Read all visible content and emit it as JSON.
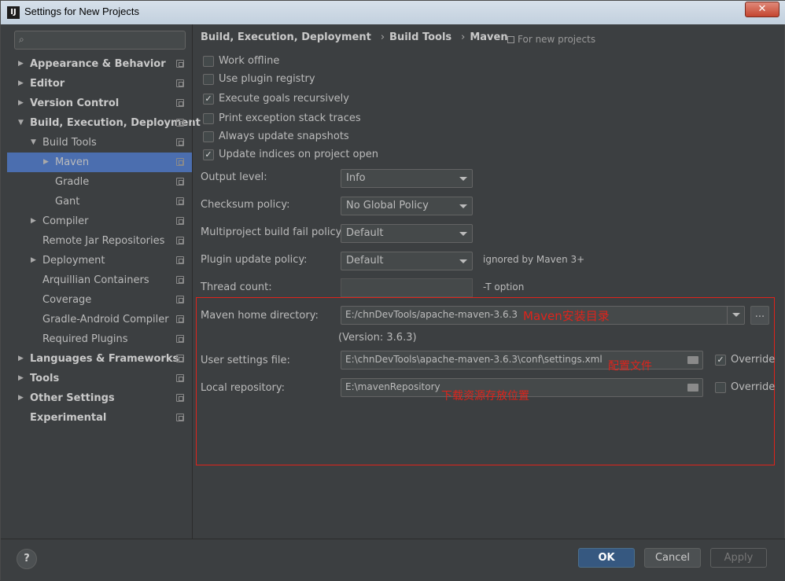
{
  "window": {
    "title": "Settings for New Projects",
    "close_label": "✕",
    "app_icon": "IJ"
  },
  "search": {
    "placeholder": "",
    "icon": "search-icon"
  },
  "sidebar": {
    "items": [
      {
        "label": "Appearance & Behavior",
        "bold": true,
        "arrow": "▶"
      },
      {
        "label": "Editor",
        "bold": true,
        "arrow": "▶"
      },
      {
        "label": "Version Control",
        "bold": true,
        "arrow": "▶"
      },
      {
        "label": "Build, Execution, Deployment",
        "bold": true,
        "arrow": "▼"
      },
      {
        "label": "Build Tools",
        "bold": false,
        "arrow": "▼"
      },
      {
        "label": "Maven",
        "bold": false,
        "arrow": "▶",
        "selected": true
      },
      {
        "label": "Gradle",
        "bold": false,
        "arrow": ""
      },
      {
        "label": "Gant",
        "bold": false,
        "arrow": ""
      },
      {
        "label": "Compiler",
        "bold": false,
        "arrow": "▶"
      },
      {
        "label": "Remote Jar Repositories",
        "bold": false,
        "arrow": ""
      },
      {
        "label": "Deployment",
        "bold": false,
        "arrow": "▶"
      },
      {
        "label": "Arquillian Containers",
        "bold": false,
        "arrow": ""
      },
      {
        "label": "Coverage",
        "bold": false,
        "arrow": ""
      },
      {
        "label": "Gradle-Android Compiler",
        "bold": false,
        "arrow": ""
      },
      {
        "label": "Required Plugins",
        "bold": false,
        "arrow": ""
      },
      {
        "label": "Languages & Frameworks",
        "bold": true,
        "arrow": "▶"
      },
      {
        "label": "Tools",
        "bold": true,
        "arrow": "▶"
      },
      {
        "label": "Other Settings",
        "bold": true,
        "arrow": "▶"
      },
      {
        "label": "Experimental",
        "bold": true,
        "arrow": ""
      }
    ]
  },
  "breadcrumb": {
    "parts": [
      "Build, Execution, Deployment",
      "Build Tools",
      "Maven"
    ],
    "separator": "›"
  },
  "for_new_projects": "For new projects",
  "checkboxes": [
    {
      "label": "Work offline",
      "checked": false
    },
    {
      "label": "Use plugin registry",
      "checked": false
    },
    {
      "label": "Execute goals recursively",
      "checked": true
    },
    {
      "label": "Print exception stack traces",
      "checked": false
    },
    {
      "label": "Always update snapshots",
      "checked": false
    },
    {
      "label": "Update indices on project open",
      "checked": true
    }
  ],
  "check_mark": "✓",
  "fields": {
    "output_level": {
      "label": "Output level:",
      "value": "Info"
    },
    "checksum_policy": {
      "label": "Checksum policy:",
      "value": "No Global Policy"
    },
    "multiproject_fail": {
      "label": "Multiproject build fail policy:",
      "value": "Default"
    },
    "plugin_update": {
      "label": "Plugin update policy:",
      "value": "Default",
      "hint": "ignored by Maven 3+"
    },
    "thread_count": {
      "label": "Thread count:",
      "value": "",
      "hint": "-T option"
    }
  },
  "maven": {
    "home_label": "Maven home directory:",
    "home_value": "E:/chnDevTools/apache-maven-3.6.3",
    "ellipsis": "...",
    "version": "(Version: 3.6.3)",
    "settings_label": "User settings file:",
    "settings_value": "E:\\chnDevTools\\apache-maven-3.6.3\\conf\\settings.xml",
    "settings_override": {
      "label": "Override",
      "checked": true
    },
    "repo_label": "Local repository:",
    "repo_value": "E:\\mavenRepository",
    "repo_override": {
      "label": "Override",
      "checked": false
    }
  },
  "annotations": {
    "home": "Maven安装目录",
    "settings": "配置文件",
    "repo": "下载资源存放位置"
  },
  "footer": {
    "help": "?",
    "ok": "OK",
    "cancel": "Cancel",
    "apply": "Apply"
  },
  "colors": {
    "background": "#3c3f41",
    "selection": "#4b6eaf",
    "annotation_red": "#e0231b",
    "ok_button": "#365880"
  }
}
